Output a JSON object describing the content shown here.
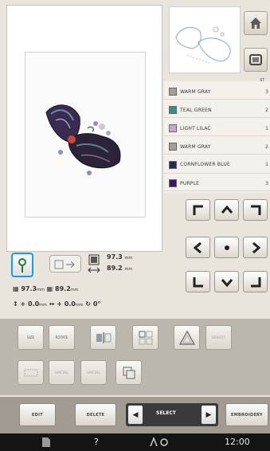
{
  "colors": {
    "accent": "#1a9be0",
    "panel": "#bcb7ae",
    "status_bar": "#141414"
  },
  "thread_list": {
    "header": "ST",
    "items": [
      {
        "name": "WARM GRAY",
        "count": "3",
        "swatch": "#a99e93"
      },
      {
        "name": "TEAL GREEN",
        "count": "2",
        "swatch": "#3d8c82"
      },
      {
        "name": "LIGHT LILAC",
        "count": "1",
        "swatch": "#c5a8cc"
      },
      {
        "name": "WARM GRAY",
        "count": "2",
        "swatch": "#a99e93"
      },
      {
        "name": "CORNFLOWER BLUE",
        "count": "1",
        "swatch": "#202a55"
      },
      {
        "name": "PURPLE",
        "count": "3",
        "swatch": "#3a1a5a"
      }
    ]
  },
  "info": {
    "width_value": "97.3",
    "width_unit": "mm",
    "height_value": "89.2",
    "height_unit": "mm",
    "field1_value": "97.3",
    "field1_unit": "mm",
    "field2_value": "89.2",
    "field2_unit": "mm",
    "x_value": "0.0",
    "x_unit": "mm",
    "y_value": "0.0",
    "y_unit": "mm",
    "angle_value": "0°"
  },
  "edit_buttons": {
    "row1": [
      {
        "label": "SIZE",
        "dim": false,
        "icon": "size-icon"
      },
      {
        "label": "ROTATE",
        "dim": false,
        "icon": "rotate-icon"
      },
      {
        "label": "",
        "dim": false,
        "icon": "mirror-icon"
      },
      {
        "label": "",
        "dim": false,
        "icon": "array-icon"
      },
      {
        "label": "",
        "dim": false,
        "icon": "triangle-icon"
      },
      {
        "label": "DENSITY",
        "dim": true,
        "icon": "density-icon"
      }
    ],
    "row2": [
      {
        "label": "",
        "dim": true,
        "icon": "border-icon"
      },
      {
        "label": "SPACING",
        "dim": true,
        "icon": "spacing-icon"
      },
      {
        "label": "SPACING",
        "dim": true,
        "icon": "spacing2-icon"
      },
      {
        "label": "",
        "dim": false,
        "icon": "duplicate-icon"
      }
    ]
  },
  "bottom_bar": {
    "edit_label": "EDIT",
    "delete_label": "DELETE",
    "select_label": "SELECT",
    "embroidery_label": "EMBROIDERY"
  },
  "status_bar": {
    "help_label": "?",
    "time": "12:00"
  }
}
